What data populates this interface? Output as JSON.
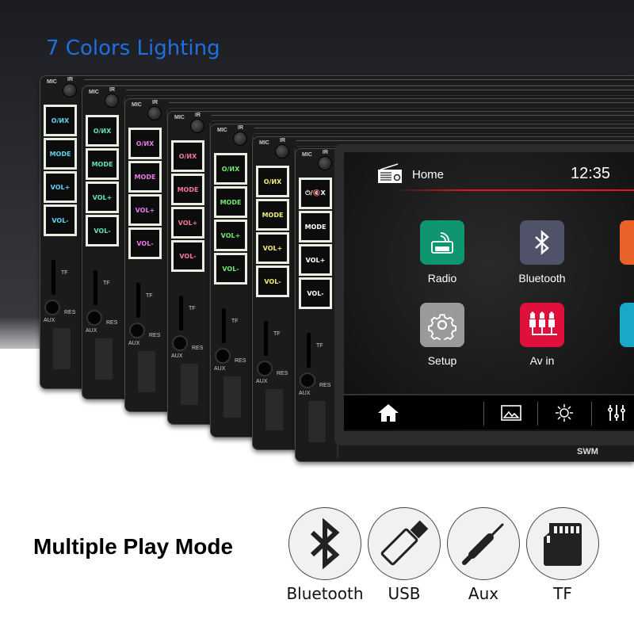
{
  "headline": "7 Colors Lighting",
  "unit_labels": {
    "mic": "MIC",
    "ir": "IR",
    "tf": "TF",
    "aux": "AUX",
    "res": "RES",
    "buttons": [
      "⏻/🔇X",
      "MODE",
      "VOL+",
      "VOL-"
    ]
  },
  "button_label_text": [
    "O/ИX",
    "MODE",
    "VOL+",
    "VOL-"
  ],
  "lighting_colors": [
    "#5fd3f3",
    "#62e3b4",
    "#e87ae8",
    "#f27898",
    "#72e66e",
    "#eeee78",
    "#ffffff"
  ],
  "screen": {
    "title": "Home",
    "clock": "12:35",
    "header_icon": "radio-icon",
    "apps": [
      {
        "label": "Radio",
        "icon": "fm-radio-icon",
        "color": "#0f9670"
      },
      {
        "label": "Bluetooth",
        "icon": "bluetooth-icon",
        "color": "#50526a"
      },
      {
        "label": "Setup",
        "icon": "gear-icon",
        "color": "#9a9a9a"
      },
      {
        "label": "Av in",
        "icon": "rca-connector-icon",
        "color": "#e0103c"
      }
    ],
    "partial_apps": [
      {
        "color": "#e8622a"
      },
      {
        "color": "#1aa8c8"
      }
    ],
    "dock": [
      "home-icon",
      "image-icon",
      "brightness-icon",
      "equalizer-icon"
    ]
  },
  "brand": "SWM",
  "play_modes": {
    "title": "Multiple Play Mode",
    "items": [
      {
        "label": "Bluetooth",
        "icon": "bluetooth-icon"
      },
      {
        "label": "USB",
        "icon": "usb-drive-icon"
      },
      {
        "label": "Aux",
        "icon": "aux-jack-icon"
      },
      {
        "label": "TF",
        "icon": "sd-card-icon"
      }
    ]
  }
}
